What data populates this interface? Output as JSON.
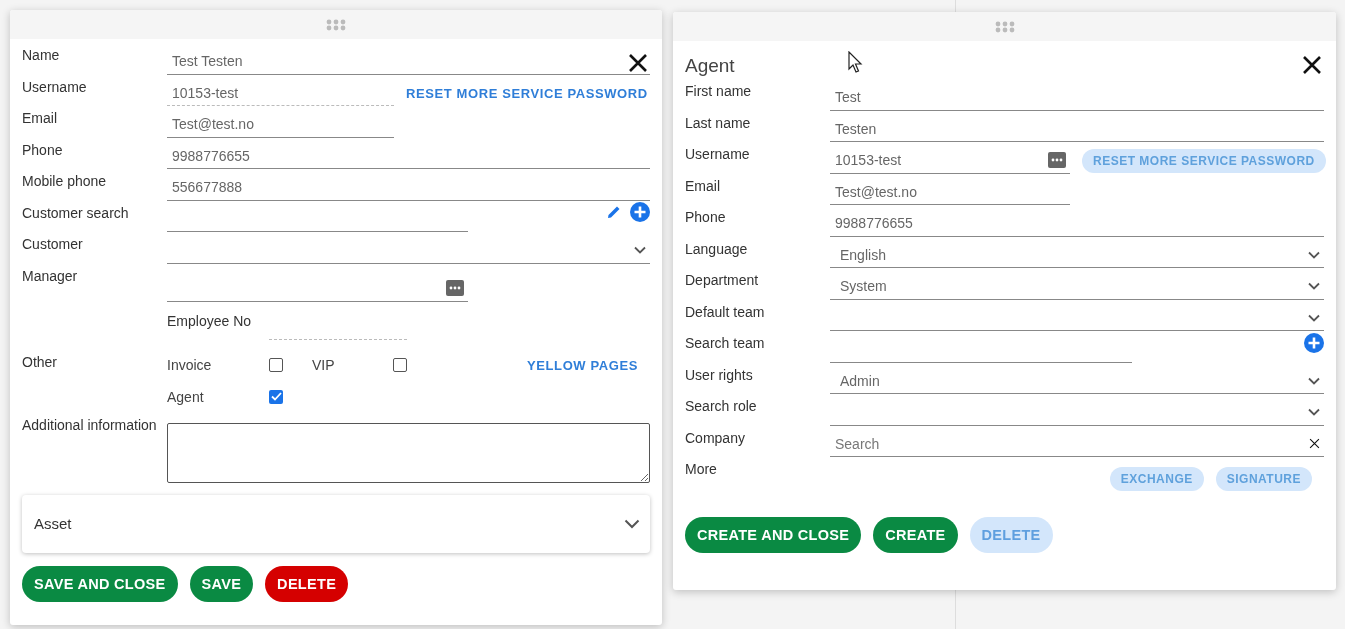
{
  "left_dialog": {
    "fields": [
      {
        "kind": "text",
        "label": "Name",
        "value": "Test Testen"
      },
      {
        "kind": "readonly",
        "label": "Username",
        "value": "10153-test",
        "action": {
          "label": "RESET MORE SERVICE PASSWORD",
          "disabled": false
        }
      },
      {
        "kind": "short-text",
        "label": "Email",
        "value": "Test@test.no"
      },
      {
        "kind": "text",
        "label": "Phone",
        "value": "9988776655"
      },
      {
        "kind": "text",
        "label": "Mobile phone",
        "value": "556677888"
      },
      {
        "kind": "search-edit",
        "label": "Customer search"
      },
      {
        "kind": "select",
        "label": "Customer"
      },
      {
        "kind": "picker",
        "label": "Manager"
      },
      {
        "kind": "inline",
        "inline_label": "Employee No"
      },
      {
        "kind": "checkboxes",
        "label": "Other",
        "options": [
          {
            "label": "Invoice",
            "checked": false
          },
          {
            "label": "VIP",
            "checked": false
          },
          {
            "label": "Agent",
            "checked": true
          }
        ],
        "link": "YELLOW PAGES"
      },
      {
        "kind": "textarea",
        "label": "Additional information"
      }
    ],
    "accordion": {
      "title": "Asset",
      "expanded": false
    },
    "buttons": [
      {
        "label": "SAVE AND CLOSE",
        "kind": "primary",
        "disabled": false
      },
      {
        "label": "SAVE",
        "kind": "primary",
        "disabled": false
      },
      {
        "label": "DELETE",
        "kind": "danger",
        "disabled": false
      }
    ]
  },
  "right_dialog": {
    "title": "Agent",
    "fields": [
      {
        "kind": "text",
        "label": "First name",
        "value": "Test"
      },
      {
        "kind": "text",
        "label": "Last name",
        "value": "Testen"
      },
      {
        "kind": "picker-text",
        "label": "Username",
        "value": "10153-test",
        "action": {
          "label": "RESET MORE SERVICE PASSWORD",
          "disabled": true
        }
      },
      {
        "kind": "short-text",
        "label": "Email",
        "value": "Test@test.no"
      },
      {
        "kind": "text",
        "label": "Phone",
        "value": "9988776655"
      },
      {
        "kind": "select",
        "label": "Language",
        "value": "English"
      },
      {
        "kind": "select",
        "label": "Department",
        "value": "System"
      },
      {
        "kind": "select",
        "label": "Default team"
      },
      {
        "kind": "search-add",
        "label": "Search team"
      },
      {
        "kind": "select",
        "label": "User rights",
        "value": "Admin"
      },
      {
        "kind": "select",
        "label": "Search role"
      },
      {
        "kind": "clearable",
        "label": "Company",
        "placeholder": "Search"
      },
      {
        "kind": "pills",
        "label": "More",
        "pills": [
          {
            "label": "EXCHANGE",
            "disabled": true
          },
          {
            "label": "SIGNATURE",
            "disabled": true
          }
        ]
      }
    ],
    "buttons": [
      {
        "label": "CREATE AND CLOSE",
        "kind": "primary",
        "disabled": false
      },
      {
        "label": "CREATE",
        "kind": "primary",
        "disabled": false
      },
      {
        "label": "DELETE",
        "kind": "primary",
        "disabled": true
      }
    ]
  }
}
